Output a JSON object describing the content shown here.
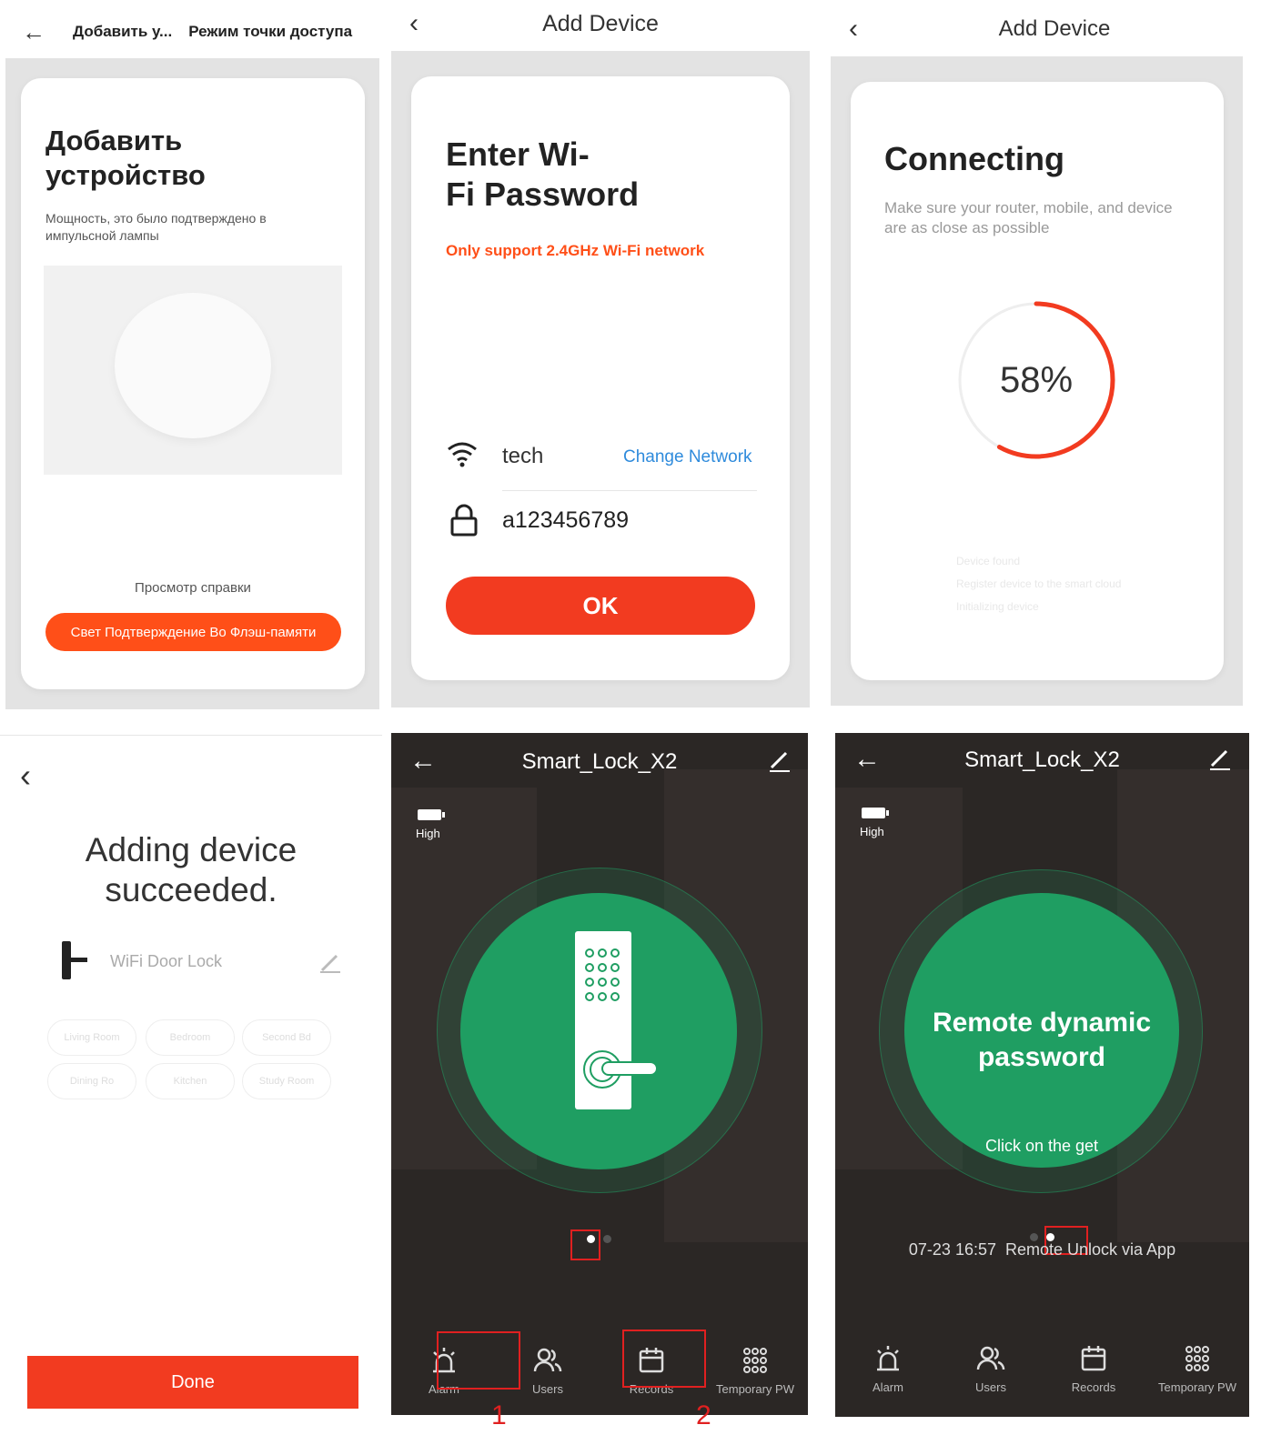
{
  "screen1": {
    "header_left": "Добавить у...",
    "header_right": "Режим точки доступа",
    "title_line1": "Добавить",
    "title_line2": "устройство",
    "description": "Мощность, это было подтверждено в импульсной лампы",
    "help_link": "Просмотр справки",
    "confirm_button": "Свет Подтверждение Во Флэш-памяти"
  },
  "screen2": {
    "header_title": "Add Device",
    "title_line1": "Enter Wi-",
    "title_line2": "Fi Password",
    "warning": "Only support 2.4GHz Wi-Fi network",
    "network_name": "tech",
    "change_network": "Change Network",
    "password": "a123456789",
    "ok_button": "OK"
  },
  "screen3": {
    "header_title": "Add Device",
    "title": "Connecting",
    "description": "Make sure your router, mobile, and device are as close as possible",
    "progress_percent": 58,
    "progress_label": "58%",
    "steps": [
      "Device found",
      "Register device to the smart cloud",
      "Initializing device"
    ]
  },
  "screen4": {
    "title_line1": "Adding device",
    "title_line2": "succeeded.",
    "device_name": "WiFi Door Lock",
    "rooms": [
      "Living Room",
      "Bedroom",
      "Second Bd",
      "Dining Ro",
      "Kitchen",
      "Study Room"
    ],
    "done_button": "Done"
  },
  "screen5": {
    "title": "Smart_Lock_X2",
    "battery_label": "High",
    "nav": [
      "Alarm",
      "Users",
      "Records",
      "Temporary PW"
    ],
    "annotation_1": "1",
    "annotation_2": "2"
  },
  "screen6": {
    "title": "Smart_Lock_X2",
    "battery_label": "High",
    "circle_title_line1": "Remote dynamic",
    "circle_title_line2": "password",
    "circle_subtitle": "Click on the get",
    "record": "07-23 16:57  Remote Unlock via App",
    "nav": [
      "Alarm",
      "Users",
      "Records",
      "Temporary PW"
    ]
  },
  "colors": {
    "accent_orange": "#ff4f18",
    "accent_red": "#f23b20",
    "link_blue": "#2f8bdc",
    "lock_green": "#1f9e62",
    "dark_bg": "#2b2725"
  }
}
